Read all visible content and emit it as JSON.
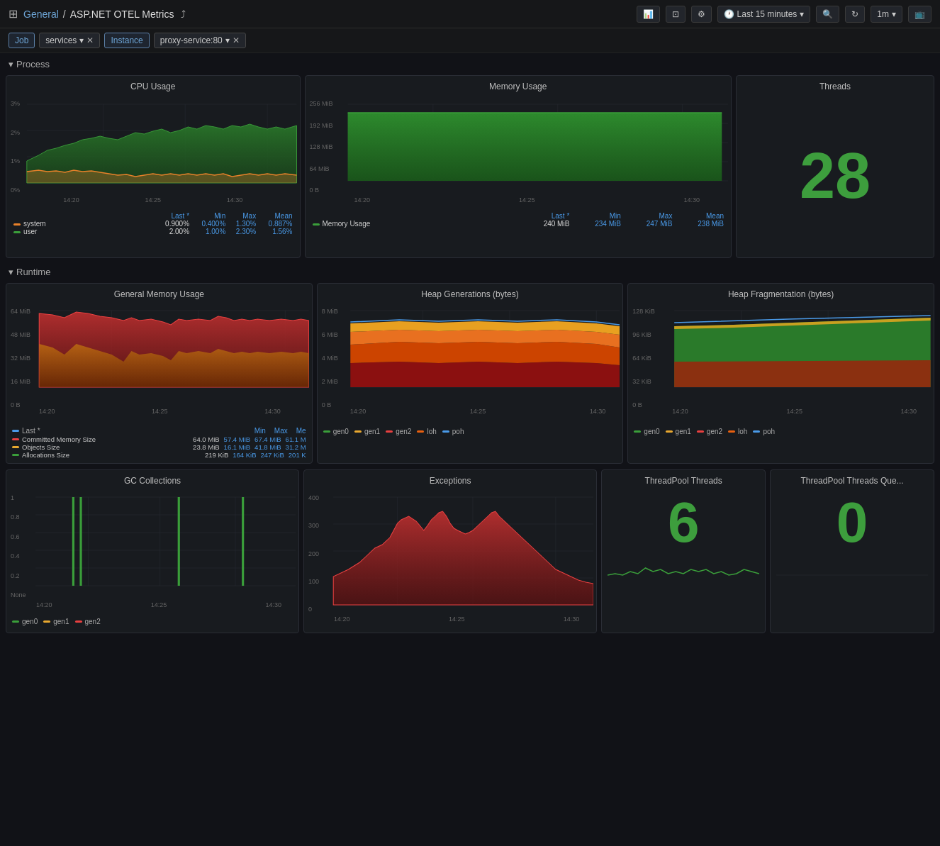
{
  "header": {
    "nav_icon": "⊞",
    "breadcrumb_home": "General",
    "separator": "/",
    "title": "ASP.NET OTEL Metrics",
    "share_icon": "share",
    "time_range": "Last 15 minutes",
    "refresh_rate": "1m"
  },
  "filters": {
    "job_label": "Job",
    "services_label": "services",
    "instance_label": "Instance",
    "proxy_label": "proxy-service:80"
  },
  "sections": {
    "process": "Process",
    "runtime": "Runtime"
  },
  "panels": {
    "cpu_usage": {
      "title": "CPU Usage",
      "y_labels": [
        "3%",
        "2%",
        "1%",
        "0%"
      ],
      "x_labels": [
        "14:20",
        "14:25",
        "14:30"
      ],
      "legend": [
        {
          "name": "system",
          "color": "#e8812a",
          "last": "0.900%",
          "min": "0.400%",
          "max": "1.30%",
          "mean": "0.887%"
        },
        {
          "name": "user",
          "color": "#3a9e3a",
          "last": "2.00%",
          "min": "1.00%",
          "max": "2.30%",
          "mean": "1.56%"
        }
      ],
      "stats_headers": [
        "Last *",
        "Min",
        "Max",
        "Mean"
      ]
    },
    "memory_usage": {
      "title": "Memory Usage",
      "y_labels": [
        "256 MiB",
        "192 MiB",
        "128 MiB",
        "64 MiB",
        "0 B"
      ],
      "x_labels": [
        "14:20",
        "14:25",
        "14:30"
      ],
      "legend": [
        {
          "name": "Memory Usage",
          "color": "#3a9e3a",
          "last": "240 MiB",
          "min": "234 MiB",
          "max": "247 MiB",
          "mean": "238 MiB"
        }
      ],
      "stats_headers": [
        "Last *",
        "Min",
        "Max",
        "Mean"
      ]
    },
    "threads": {
      "title": "Threads",
      "value": "28"
    },
    "general_memory": {
      "title": "General Memory Usage",
      "y_labels": [
        "64 MiB",
        "48 MiB",
        "32 MiB",
        "16 MiB",
        "0 B"
      ],
      "x_labels": [
        "14:20",
        "14:25",
        "14:30"
      ],
      "legend": [
        {
          "name": "Committed Memory Size",
          "color": "#e84040",
          "last": "64.0 MiB",
          "min": "57.4 MiB",
          "max": "67.4 MiB",
          "mean": "61.1 M"
        },
        {
          "name": "Objects Size",
          "color": "#e8a830",
          "last": "23.8 MiB",
          "min": "16.1 MiB",
          "max": "41.8 MiB",
          "mean": "31.2 M"
        },
        {
          "name": "Allocations Size",
          "color": "#3a9e3a",
          "last": "219 KiB",
          "min": "164 KiB",
          "max": "247 KiB",
          "mean": "201 K"
        }
      ]
    },
    "heap_generations": {
      "title": "Heap Generations (bytes)",
      "y_labels": [
        "8 MiB",
        "6 MiB",
        "4 MiB",
        "2 MiB",
        "0 B"
      ],
      "x_labels": [
        "14:20",
        "14:25",
        "14:30"
      ],
      "legend": [
        {
          "name": "gen0",
          "color": "#3a9e3a"
        },
        {
          "name": "gen1",
          "color": "#e8a830"
        },
        {
          "name": "gen2",
          "color": "#e84040"
        },
        {
          "name": "loh",
          "color": "#e86010"
        },
        {
          "name": "poh",
          "color": "#4a9ae8"
        }
      ]
    },
    "heap_fragmentation": {
      "title": "Heap Fragmentation (bytes)",
      "y_labels": [
        "128 KiB",
        "96 KiB",
        "64 KiB",
        "32 KiB",
        "0 B"
      ],
      "x_labels": [
        "14:20",
        "14:25",
        "14:30"
      ],
      "legend": [
        {
          "name": "gen0",
          "color": "#3a9e3a"
        },
        {
          "name": "gen1",
          "color": "#e8a830"
        },
        {
          "name": "gen2",
          "color": "#e86010"
        },
        {
          "name": "loh",
          "color": "#e84040"
        },
        {
          "name": "poh",
          "color": "#4a9ae8"
        }
      ]
    },
    "gc_collections": {
      "title": "GC Collections",
      "y_labels": [
        "1",
        "0.8",
        "0.6",
        "0.4",
        "0.2",
        "None"
      ],
      "x_labels": [
        "14:20",
        "14:25",
        "14:30"
      ],
      "legend": [
        {
          "name": "gen0",
          "color": "#3a9e3a"
        },
        {
          "name": "gen1",
          "color": "#e8a830"
        },
        {
          "name": "gen2",
          "color": "#e84040"
        }
      ]
    },
    "exceptions": {
      "title": "Exceptions",
      "y_labels": [
        "400",
        "300",
        "200",
        "100",
        "0"
      ],
      "x_labels": [
        "14:20",
        "14:25",
        "14:30"
      ]
    },
    "threadpool_threads": {
      "title": "ThreadPool Threads",
      "value": "6"
    },
    "threadpool_queue": {
      "title": "ThreadPool Threads Que...",
      "value": "0"
    }
  }
}
